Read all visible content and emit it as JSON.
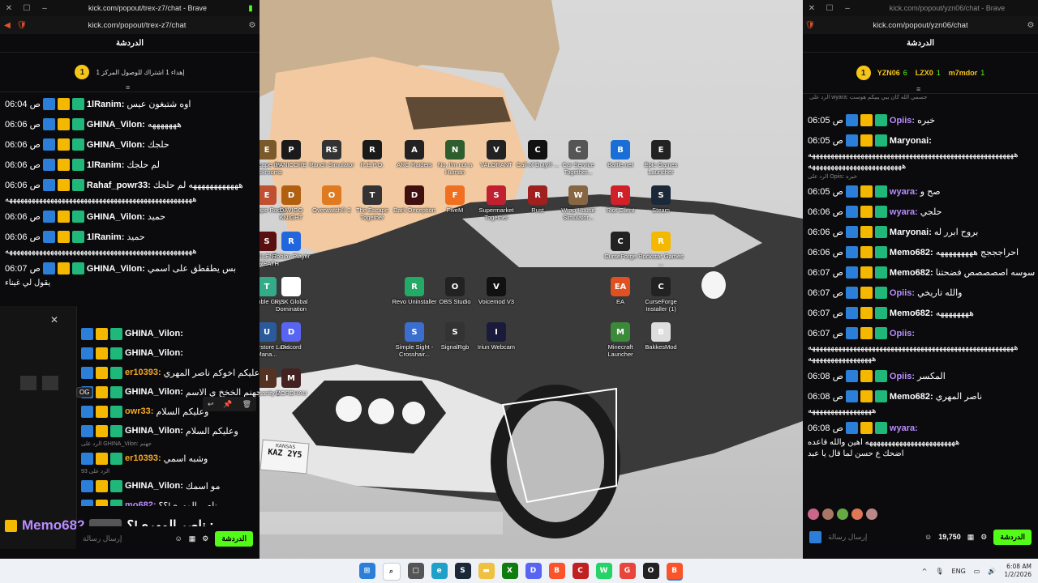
{
  "left_window": {
    "title": "kick.com/popout/trex-z7/chat - Brave",
    "url": "kick.com/popout/trex-z7/chat",
    "chat_header": "الدردشة",
    "pin_count": "1",
    "pin_text": "إهداء 1 اشتراك للوصول المركز 1",
    "messages": [
      {
        "time": "06:04 ص",
        "user": "1lRanim",
        "text": "اوه شتبغون عيس",
        "color": "#ffffff"
      },
      {
        "time": "06:06 ص",
        "user": "GHINA_Vilon",
        "text": "هههههههه",
        "color": "#ffffff"
      },
      {
        "time": "06:06 ص",
        "user": "GHINA_Vilon",
        "text": "حلجك",
        "color": "#ffffff"
      },
      {
        "time": "06:06 ص",
        "user": "1lRanim",
        "text": "لم حلجك",
        "color": "#ffffff"
      },
      {
        "time": "06:06 ص",
        "user": "Rahaf_powr33",
        "text": "ههههههههههههه لم حلجك",
        "color": "#ffffff"
      },
      {
        "time": "06:06 ص",
        "user": "GHINA_Vilon",
        "text": "حميد",
        "color": "#ffffff"
      },
      {
        "time": "06:06 ص",
        "user": "1lRanim",
        "text": "حميد",
        "color": "#ffffff"
      },
      {
        "time": "06:07 ص",
        "user": "GHINA_Vilon",
        "text": "بس يطقطق على اسمي",
        "color": "#ffffff"
      }
    ],
    "long_line": "ههههههههههههههههههههههههههههههههههههههههههههههههههه",
    "extra_line": "يقول لي غيناء",
    "lower_messages": [
      {
        "user": "GHINA_Vilon",
        "text": ""
      },
      {
        "user": "GHINA_Vilon",
        "text": ""
      },
      {
        "user": "er10393",
        "text": "سلام عليكم اخوكم ناصر المهري"
      },
      {
        "user": "GHINA_Vilon",
        "text": "جهنم الخخخ ي الاسم"
      },
      {
        "user": "owr33",
        "text": "وعليكم السلام"
      },
      {
        "user": "GHINA_Vilon",
        "text": "وعليكم السلام"
      },
      {
        "user": "er10393",
        "text": "وشبه اسمي"
      },
      {
        "user": "GHINA_Vilon",
        "text": "مو اسمك"
      },
      {
        "user": "mo682",
        "text": "ناصر المهري!؟؟"
      }
    ],
    "reply_hint_1": "الرد على GHINA_Vilon: جهنم",
    "reply_hint_2": "الرد على 93",
    "og_badge": "OG",
    "big_user": "Memo682",
    "big_text": "ناصر المهري!؟ :",
    "input_placeholder": "إرسال رسالة",
    "chat_button": "الدردشة"
  },
  "right_window": {
    "title": "kick.com/popout/yzn06/chat - Brave",
    "url": "kick.com/popout/yzn06/chat",
    "chat_header": "الدردشة",
    "leaders": [
      {
        "name": "YZN06",
        "count": "6"
      },
      {
        "name": "LZX0",
        "count": "1"
      },
      {
        "name": "m7mdor",
        "count": "1"
      }
    ],
    "pin_count": "1",
    "reply_top": "الرد على wyara: جسمي الله كان يبي يبيكم هوست",
    "messages": [
      {
        "time": "06:05 ص",
        "user": "Opiis",
        "text": "خيره",
        "color": "#b98cff"
      },
      {
        "time": "06:05 ص",
        "user": "Maryonai",
        "text": "",
        "color": "#ffffff"
      },
      {
        "time": "06:05 ص",
        "user": "wyara",
        "text": "صح و",
        "color": "#b98cff"
      },
      {
        "time": "06:06 ص",
        "user": "wyara",
        "text": "حلجي",
        "color": "#b98cff"
      },
      {
        "time": "06:06 ص",
        "user": "Maryonai",
        "text": "بروح ابرر له",
        "color": "#ffffff"
      },
      {
        "time": "06:06 ص",
        "user": "Memo682",
        "text": "احراجججج هههههههههه",
        "color": "#ffffff"
      },
      {
        "time": "06:07 ص",
        "user": "Memo682",
        "text": "سوسه اصصصصص فضحتنا",
        "color": "#ffffff"
      },
      {
        "time": "06:07 ص",
        "user": "Opiis",
        "text": "والله تاريخي",
        "color": "#b98cff"
      },
      {
        "time": "06:07 ص",
        "user": "Memo682",
        "text": "ههههههههه",
        "color": "#ffffff"
      },
      {
        "time": "06:07 ص",
        "user": "Opiis",
        "text": "",
        "color": "#b98cff"
      },
      {
        "time": "06:08 ص",
        "user": "Opiis",
        "text": "المكسر",
        "color": "#b98cff"
      },
      {
        "time": "06:08 ص",
        "user": "Memo682",
        "text": "ناصر المهري",
        "color": "#ffffff"
      },
      {
        "time": "06:08 ص",
        "user": "wyara",
        "text": "",
        "color": "#b98cff"
      }
    ],
    "reply_mid": "الرد على Opiis: خيره",
    "long_a": "هههههههههههههههههههههههههههههههههههههههههههههههههههههههه",
    "long_b": "هههههههههههههههههههههههههه",
    "long_c": "هههههههههههههههههه",
    "long_d": "ههههههههههههههههههههههههه اهين والله قاعده",
    "long_e": "اضحك ع حسن لما قال يا عبد",
    "points": "19,750",
    "input_placeholder": "إرسال رسالة",
    "chat_button": "الدردشة"
  },
  "desktop": {
    "icons": [
      {
        "label": "Escape the Backrooms",
        "color": "#7a5a2a",
        "glyph": "E"
      },
      {
        "label": "PANICORE",
        "color": "#1a1a1a",
        "glyph": "P"
      },
      {
        "label": "Ranch Simulator",
        "color": "#333",
        "glyph": "RS"
      },
      {
        "label": "R.E.P.O.",
        "color": "#1a1a1a",
        "glyph": "R"
      },
      {
        "label": "ARC Raiders",
        "color": "#222",
        "glyph": "A"
      },
      {
        "label": "No, I'm not a Human",
        "color": "#2e5e2e",
        "glyph": "N"
      },
      {
        "label": "VALORANT",
        "color": "#222",
        "glyph": "V"
      },
      {
        "label": "Call of Duty® ...",
        "color": "#111",
        "glyph": "C"
      },
      {
        "label": "Car Service Together...",
        "color": "#555",
        "glyph": "C"
      },
      {
        "label": "Battle.net",
        "color": "#1a6fd6",
        "glyph": "B"
      },
      {
        "label": "Epic Games Launcher",
        "color": "#222",
        "glyph": "E"
      },
      {
        "label": "Escape Room",
        "color": "#c05030",
        "glyph": "E"
      },
      {
        "label": "DAVIGO KNIGHT",
        "color": "#b06010",
        "glyph": "D"
      },
      {
        "label": "Overwatch® 2",
        "color": "#e07a20",
        "glyph": "O"
      },
      {
        "label": "The Escape Together",
        "color": "#333",
        "glyph": "T"
      },
      {
        "label": "Dark Deception",
        "color": "#401010",
        "glyph": "D"
      },
      {
        "label": "FiveM",
        "color": "#f07020",
        "glyph": "F"
      },
      {
        "label": "Supermarket Together",
        "color": "#c02030",
        "glyph": "S"
      },
      {
        "label": "Rust",
        "color": "#a02020",
        "glyph": "R"
      },
      {
        "label": "Wrap House Simulator...",
        "color": "#886644",
        "glyph": "W"
      },
      {
        "label": "Riot Client",
        "color": "#d0202a",
        "glyph": "R"
      },
      {
        "label": "Steam",
        "color": "#1b2838",
        "glyph": "S"
      },
      {
        "label": "SILENT BREATH",
        "color": "#5a1010",
        "glyph": "S"
      },
      {
        "label": "Roblox Player",
        "color": "#2266dd",
        "glyph": "R"
      },
      {
        "label": "CurseForge",
        "color": "#222",
        "glyph": "C"
      },
      {
        "label": "Rockstar Games ...",
        "color": "#f5b800",
        "glyph": "R"
      },
      {
        "label": "Tumble Guys",
        "color": "#3a8",
        "glyph": "T"
      },
      {
        "label": "RiSK Global Domination",
        "color": "#fff",
        "glyph": "R"
      },
      {
        "label": "Revo Uninstaller",
        "color": "#2a6",
        "glyph": "R"
      },
      {
        "label": "OBS Studio",
        "color": "#222",
        "glyph": "O"
      },
      {
        "label": "Voicemod V3",
        "color": "#111",
        "glyph": "V"
      },
      {
        "label": "EA",
        "color": "#e05020",
        "glyph": "EA"
      },
      {
        "label": "CurseForge Installer (1)",
        "color": "#222",
        "glyph": "C"
      },
      {
        "label": "Understore Land Mana...",
        "color": "#2a5a9a",
        "glyph": "U"
      },
      {
        "label": "Discord",
        "color": "#5865f2",
        "glyph": "D"
      },
      {
        "label": "Simple Sight - Crosshair...",
        "color": "#3a6fd0",
        "glyph": "S"
      },
      {
        "label": "SignalRgb",
        "color": "#333",
        "glyph": "S"
      },
      {
        "label": "Iriun Webcam",
        "color": "#1a1a3a",
        "glyph": "I"
      },
      {
        "label": "Minecraft Launcher",
        "color": "#3a8a3a",
        "glyph": "M"
      },
      {
        "label": "BakkesMod",
        "color": "#ddd",
        "glyph": "B"
      },
      {
        "label": "Insanity 2",
        "color": "#553322",
        "glyph": "I"
      },
      {
        "label": "MORDHAU",
        "color": "#442222",
        "glyph": "M"
      }
    ],
    "plate_state": "KANSAS",
    "plate_number": "KAZ 2Y5"
  },
  "taskbar": {
    "lang": "ENG",
    "time": "6:08 AM",
    "date": "1/2/2026"
  }
}
